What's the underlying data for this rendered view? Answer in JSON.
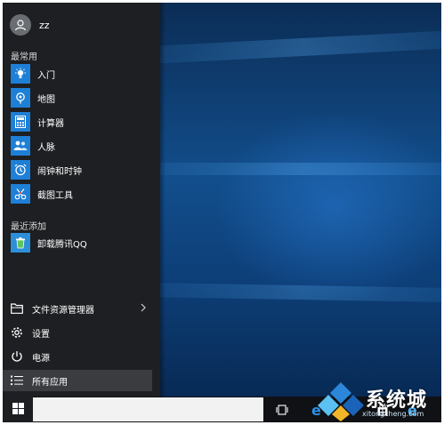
{
  "user": {
    "name": "zz",
    "avatar_icon": "user-avatar-icon"
  },
  "sections": {
    "most_used": "最常用",
    "recently_added": "最近添加"
  },
  "most_used_apps": [
    {
      "label": "入门",
      "icon": "lightbulb-icon"
    },
    {
      "label": "地图",
      "icon": "map-icon"
    },
    {
      "label": "计算器",
      "icon": "calculator-icon"
    },
    {
      "label": "人脉",
      "icon": "people-icon"
    },
    {
      "label": "闹钟和时钟",
      "icon": "alarm-clock-icon"
    },
    {
      "label": "截图工具",
      "icon": "scissors-icon"
    }
  ],
  "recent_apps": [
    {
      "label": "卸载腾讯QQ",
      "icon": "uninstall-icon"
    }
  ],
  "bottom_menu": {
    "file_explorer": "文件资源管理器",
    "settings": "设置",
    "power": "电源",
    "all_apps": "所有应用"
  },
  "taskbar": {
    "search_placeholder": "",
    "icons": [
      "windows-logo-icon",
      "task-view-icon",
      "edge-icon",
      "store-icon",
      "ie-icon"
    ]
  },
  "watermark": {
    "text": "系统城",
    "url": "xitongcheng.com"
  },
  "colors": {
    "accent": "#1e7fd6",
    "menu_bg": "#1d1f22",
    "taskbar_bg": "#0f1114"
  }
}
